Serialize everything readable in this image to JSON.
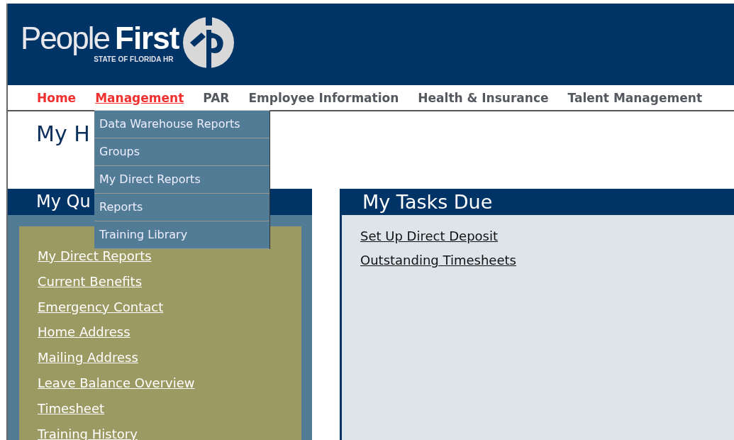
{
  "header": {
    "logo": {
      "word_1": "People",
      "word_2": "First",
      "tagline": "STATE OF FLORIDA HR"
    }
  },
  "nav": [
    {
      "label": "Home",
      "highlighted": true,
      "open": false
    },
    {
      "label": "Management",
      "highlighted": true,
      "open": true
    },
    {
      "label": "PAR",
      "highlighted": false,
      "open": false
    },
    {
      "label": "Employee Information",
      "highlighted": false,
      "open": false
    },
    {
      "label": "Health & Insurance",
      "highlighted": false,
      "open": false
    },
    {
      "label": "Talent Management",
      "highlighted": false,
      "open": false
    }
  ],
  "dropdown": [
    "Data Warehouse Reports",
    "Groups",
    "My Direct Reports",
    "Reports",
    "Training Library"
  ],
  "page_title": "My H",
  "quick_links": {
    "title": "My Qu",
    "links": [
      "My Direct Reports",
      "Current Benefits",
      "Emergency Contact",
      "Home Address",
      "Mailing Address",
      "Leave Balance Overview",
      "Timesheet",
      "Training History"
    ]
  },
  "tasks_due": {
    "title": "My Tasks Due",
    "links": [
      "Set Up Direct Deposit",
      "Outstanding Timesheets"
    ]
  }
}
